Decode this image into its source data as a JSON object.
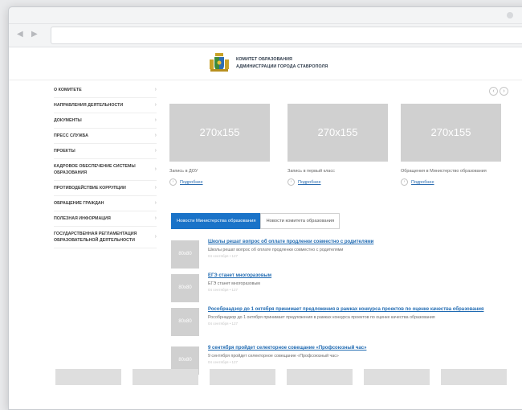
{
  "header": {
    "line1": "КОМИТЕТ ОБРАЗОВАНИЯ",
    "line2": "АДМИНИСТРАЦИИ ГОРОДА СТАВРОПОЛЯ"
  },
  "sidebar": {
    "items": [
      {
        "label": "О КОМИТЕТЕ"
      },
      {
        "label": "НАПРАВЛЕНИЯ ДЕЯТЕЛЬНОСТИ"
      },
      {
        "label": "ДОКУМЕНТЫ"
      },
      {
        "label": "ПРЕСС СЛУЖБА"
      },
      {
        "label": "ПРОЕКТЫ"
      },
      {
        "label": "КАДРОВОЕ ОБЕСПЕЧЕНИЕ СИСТЕМЫ ОБРАЗОВАНИЯ"
      },
      {
        "label": "ПРОТИВОДЕЙСТВИЕ КОРРУПЦИИ"
      },
      {
        "label": "ОБРАЩЕНИЕ ГРАЖДАН"
      },
      {
        "label": "ПОЛЕЗНАЯ ИНФОРМАЦИЯ"
      },
      {
        "label": "ГОСУДАРСТВЕННАЯ РЕГЛАМЕНТАЦИЯ ОБРАЗОВАТЕЛЬНОЙ ДЕЯТЕЛЬНОСТИ"
      }
    ]
  },
  "cards": [
    {
      "thumb": "270x155",
      "title": "Запись в ДОУ",
      "more": "Подробнее"
    },
    {
      "thumb": "270x155",
      "title": "Запись в первый класс",
      "more": "Подробнее"
    },
    {
      "thumb": "270x155",
      "title": "Обращения в Министерство образования",
      "more": "Подробнее"
    }
  ],
  "tabs": {
    "active": "Новости Министерства образования",
    "inactive": "Новости комитета образования"
  },
  "news": [
    {
      "thumb": "80x80",
      "title": "Школы решат вопрос об оплате продленки совместно с родителями",
      "desc": "Школы решат вопрос об оплате продленки совместно с родителями",
      "meta": "04 сентября • 127"
    },
    {
      "thumb": "80x80",
      "title": "ЕГЭ станет многоразовым",
      "desc": "ЕГЭ станет многоразовым",
      "meta": "04 сентября • 127"
    },
    {
      "thumb": "80x80",
      "title": "Рособрнадзор до 1 октября принимает предложения в рамках конкурса проектов по оценке качества образования",
      "desc": "Рособрнадзор до 1 октября принимает предложения в рамках конкурса проектов по оценке качества образования",
      "meta": "04 сентября • 127"
    },
    {
      "thumb": "80x80",
      "title": "9 сентября пройдет селекторное совещание «Профсоюзный час»",
      "desc": "9 сентября пройдет селекторное совещание «Профсоюзный час»",
      "meta": "04 сентября • 127"
    }
  ],
  "icons": {
    "back": "chevron-left-icon",
    "forward": "chevron-right-icon",
    "logo": "coat-of-arms-icon"
  },
  "colors": {
    "accent": "#1a73c8",
    "link": "#1f6ab2",
    "placeholder": "#d0d0d0"
  }
}
